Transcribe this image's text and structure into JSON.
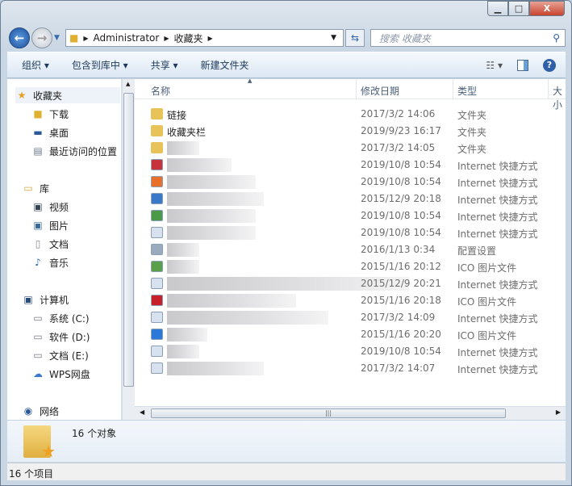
{
  "address": {
    "crumbs": [
      "Administrator",
      "收藏夹"
    ]
  },
  "search": {
    "placeholder": "搜索 收藏夹"
  },
  "toolbar": {
    "organize": "组织 ▾",
    "include": "包含到库中 ▾",
    "share": "共享 ▾",
    "new_folder": "新建文件夹"
  },
  "sidebar": {
    "favorites": "收藏夹",
    "downloads": "下载",
    "desktop": "桌面",
    "recent": "最近访问的位置",
    "libraries": "库",
    "videos": "视频",
    "pictures": "图片",
    "documents": "文档",
    "music": "音乐",
    "computer": "计算机",
    "drive_c": "系统 (C:)",
    "drive_d": "软件 (D:)",
    "drive_e": "文档 (E:)",
    "wps": "WPS网盘",
    "network": "网络"
  },
  "columns": {
    "name": "名称",
    "date": "修改日期",
    "type": "类型",
    "size": "大小"
  },
  "files": [
    {
      "name": "链接",
      "date": "2017/3/2 14:06",
      "type": "文件夹",
      "icon": "folder",
      "color": "#e8c35a"
    },
    {
      "name": "收藏夹栏",
      "date": "2019/9/23 16:17",
      "type": "文件夹",
      "icon": "folder",
      "color": "#e8c35a"
    },
    {
      "name": "",
      "date": "2017/3/2 14:05",
      "type": "文件夹",
      "icon": "folder",
      "color": "#e8c35a"
    },
    {
      "name": "",
      "date": "2019/10/8 10:54",
      "type": "Internet 快捷方式",
      "icon": "shortcut",
      "color": "#c8323a"
    },
    {
      "name": "",
      "date": "2019/10/8 10:54",
      "type": "Internet 快捷方式",
      "icon": "shortcut",
      "color": "#e8702a"
    },
    {
      "name": "",
      "date": "2015/12/9 20:18",
      "type": "Internet 快捷方式",
      "icon": "shortcut",
      "color": "#3a78c8"
    },
    {
      "name": "",
      "date": "2019/10/8 10:54",
      "type": "Internet 快捷方式",
      "icon": "shortcut",
      "color": "#4a9a4a"
    },
    {
      "name": "",
      "date": "2019/10/8 10:54",
      "type": "Internet 快捷方式",
      "icon": "shortcut",
      "color": "#d8e2ee"
    },
    {
      "name": "",
      "date": "2016/1/13 0:34",
      "type": "配置设置",
      "icon": "config",
      "color": "#9aabbd"
    },
    {
      "name": "",
      "date": "2015/1/16 20:12",
      "type": "ICO 图片文件",
      "icon": "image",
      "color": "#5aa04a"
    },
    {
      "name": "",
      "date": "2015/12/9 20:21",
      "type": "Internet 快捷方式",
      "icon": "shortcut",
      "color": "#d8e2ee"
    },
    {
      "name": "",
      "date": "2015/1/16 20:18",
      "type": "ICO 图片文件",
      "icon": "jd",
      "color": "#c8202a"
    },
    {
      "name": "",
      "date": "2017/3/2 14:09",
      "type": "Internet 快捷方式",
      "icon": "shortcut",
      "color": "#d8e2ee"
    },
    {
      "name": "",
      "date": "2015/1/16 20:20",
      "type": "ICO 图片文件",
      "icon": "image",
      "color": "#2a78d8"
    },
    {
      "name": "",
      "date": "2019/10/8 10:54",
      "type": "Internet 快捷方式",
      "icon": "shortcut",
      "color": "#d8e2ee"
    },
    {
      "name": "",
      "date": "2017/3/2 14:07",
      "type": "Internet 快捷方式",
      "icon": "shortcut",
      "color": "#d8e2ee"
    }
  ],
  "details": {
    "count": "16 个对象"
  },
  "status": {
    "text": "16 个项目"
  }
}
